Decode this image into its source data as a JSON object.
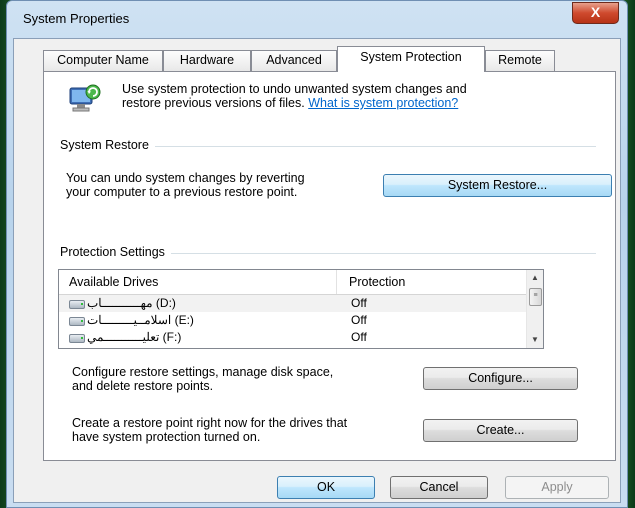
{
  "window": {
    "title": "System Properties",
    "close_glyph": "X"
  },
  "tabs": [
    {
      "label": "Computer Name"
    },
    {
      "label": "Hardware"
    },
    {
      "label": "Advanced"
    },
    {
      "label": "System Protection",
      "active": true
    },
    {
      "label": "Remote"
    }
  ],
  "intro": {
    "line1": "Use system protection to undo unwanted system changes and",
    "line2": "restore previous versions of files.",
    "link": "What is system protection?",
    "icon": "system-protection-icon"
  },
  "system_restore": {
    "group_label": "System Restore",
    "desc_line1": "You can undo system changes by reverting",
    "desc_line2": "your computer to a previous restore point.",
    "button": "System Restore..."
  },
  "protection": {
    "group_label": "Protection Settings",
    "columns": [
      "Available Drives",
      "Protection"
    ],
    "drives": [
      {
        "name": "مهـــــــــــاب (D:)",
        "protection": "Off",
        "icon": "drive-icon",
        "selected": true
      },
      {
        "name": "اسلامــيـــــــــات (E:)",
        "protection": "Off",
        "icon": "drive-icon"
      },
      {
        "name": "تعليـــــــــــمي (F:)",
        "protection": "Off",
        "icon": "drive-icon"
      }
    ],
    "configure_line1": "Configure restore settings, manage disk space,",
    "configure_line2": "and delete restore points.",
    "configure_button": "Configure...",
    "create_line1": "Create a restore point right now for the drives that",
    "create_line2": "have system protection turned on.",
    "create_button": "Create..."
  },
  "footer": {
    "ok": "OK",
    "cancel": "Cancel",
    "apply": "Apply"
  }
}
